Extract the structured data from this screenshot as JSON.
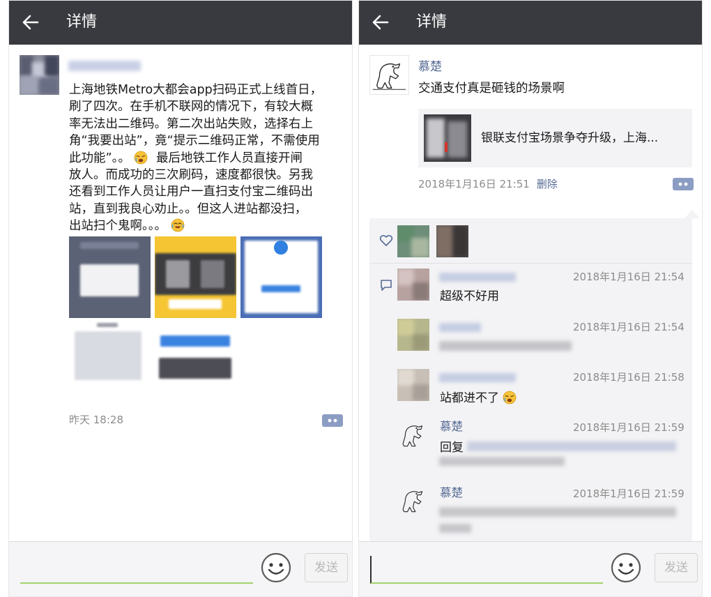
{
  "left": {
    "title": "详情",
    "post": {
      "text_lines": [
        "上海地铁Metro大都会app扫码正式上线首日，",
        "刷了四次。在手机不联网的情况下，有较大概",
        "率无法出二维码。第二次出站失败，选择右上",
        "角“我要出站”，竟“提示二维码正常，不需使用",
        "此功能”。。",
        "最后地铁工作人员直接开闸",
        "放人。而成功的三次刷码，速度都很快。另我",
        "还看到工作人员让用户一直扫支付宝二维码出",
        "站，直到我良心劝止。。但这人进站都没扫，",
        "出站扫个鬼啊。。。"
      ],
      "time": "昨天 18:28",
      "icons": [
        "back-arrow-icon",
        "weary-face-emoji",
        "tears-of-joy-emoji",
        "comment-more-icon"
      ]
    },
    "input": {
      "placeholder": "",
      "send_label": "发送"
    }
  },
  "right": {
    "title": "详情",
    "post": {
      "author": "慕楚",
      "text": "交通支付真是砸钱的场景啊",
      "link_title": "银联支付宝场景争夺升级，上海...",
      "time": "2018年1月16日 21:51",
      "delete_label": "删除"
    },
    "comments": [
      {
        "nick": "",
        "time": "2018年1月16日 21:54",
        "text": "超级不好用"
      },
      {
        "nick": "",
        "time": "2018年1月16日 21:54",
        "text": ""
      },
      {
        "nick": "",
        "time": "2018年1月16日 21:58",
        "text": "站都进不了"
      },
      {
        "nick": "慕楚",
        "time": "2018年1月16日 21:59",
        "text": "回复"
      },
      {
        "nick": "慕楚",
        "time": "2018年1月16日 21:59",
        "text": ""
      }
    ],
    "icons": [
      "back-arrow-icon",
      "heart-icon",
      "comment-icon",
      "dinosaur-avatar",
      "smiley-icon"
    ],
    "input": {
      "placeholder": "",
      "send_label": "发送"
    }
  },
  "colors": {
    "topbar": "#393a3f",
    "link": "#576b95",
    "meta": "#8c8c8c",
    "input_underline": "#a3d36a"
  }
}
